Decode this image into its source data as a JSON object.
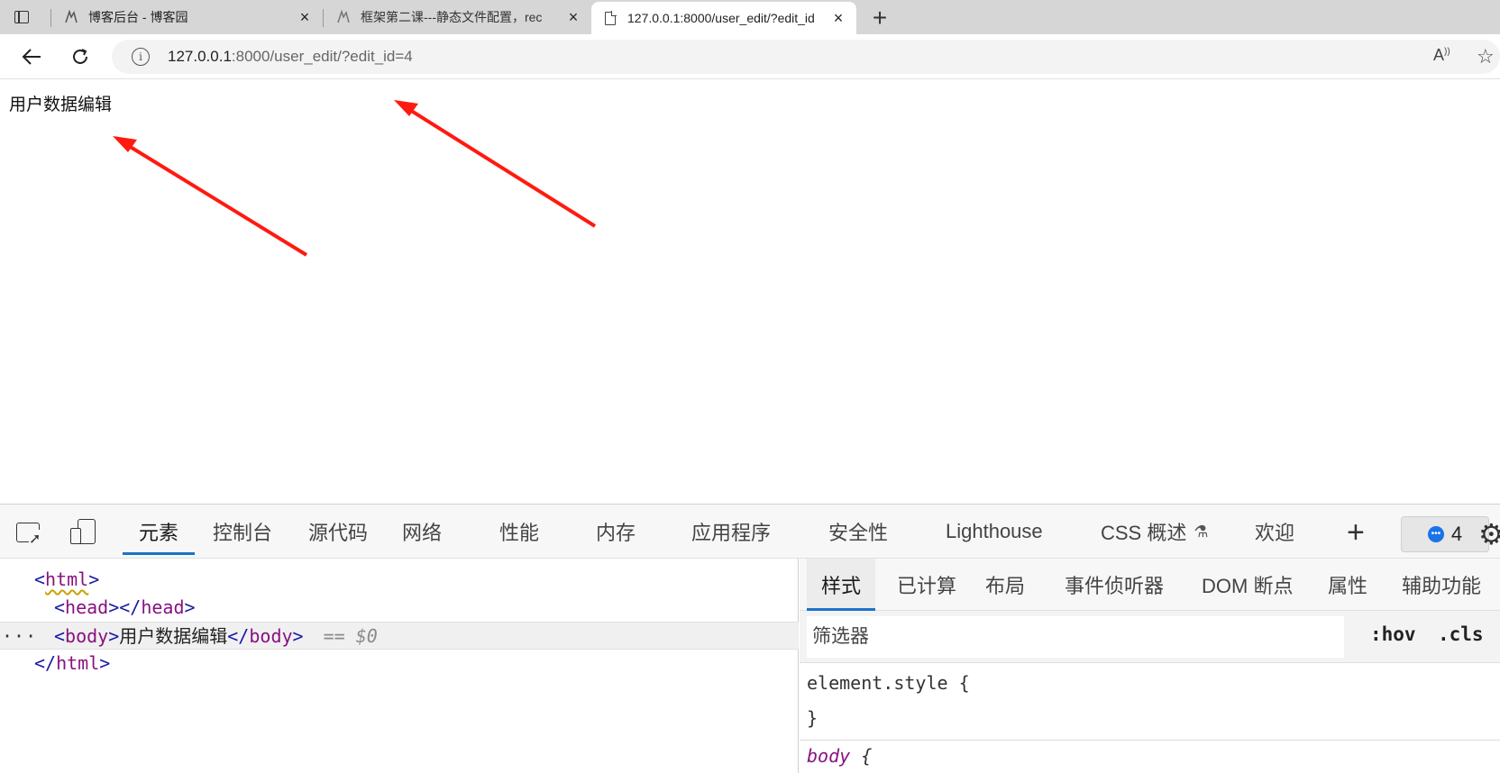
{
  "browser": {
    "tabs": [
      {
        "title": "博客后台 - 博客园",
        "favicon": "cnblogs-icon"
      },
      {
        "title": "框架第二课---静态文件配置，rec",
        "favicon": "cnblogs-icon"
      },
      {
        "title": "127.0.0.1:8000/user_edit/?edit_id",
        "favicon": "document-icon"
      }
    ],
    "new_tab_label": "+",
    "address": {
      "host": "127.0.0.1",
      "rest": ":8000/user_edit/?edit_id=4"
    }
  },
  "page": {
    "text": "用户数据编辑",
    "annotation_color": "#ff1a0f"
  },
  "devtools": {
    "tabs": [
      "元素",
      "控制台",
      "源代码",
      "网络",
      "性能",
      "内存",
      "应用程序",
      "安全性",
      "Lighthouse",
      "CSS 概述",
      "欢迎"
    ],
    "active_tab": "元素",
    "issues_count": "4",
    "dom": {
      "html_open": "html",
      "head": "head",
      "body_tag": "body",
      "body_text": "用户数据编辑",
      "selected_ref": "== $0",
      "dots": "···"
    },
    "styles": {
      "tabs": [
        "样式",
        "已计算",
        "布局",
        "事件侦听器",
        "DOM 断点",
        "属性",
        "辅助功能"
      ],
      "active_tab": "样式",
      "filter_placeholder": "筛选器",
      "hov": ":hov",
      "cls": ".cls",
      "rules": [
        "element.style {",
        "}",
        "body",
        "{"
      ]
    }
  }
}
